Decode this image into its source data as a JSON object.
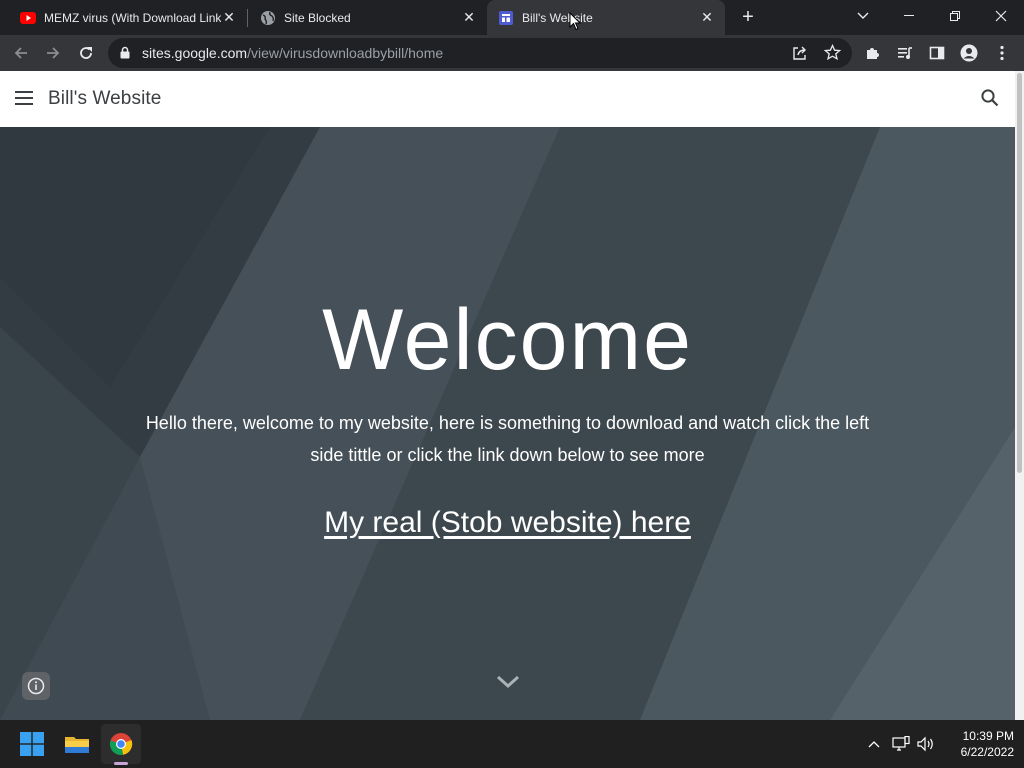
{
  "browser": {
    "tabs": [
      {
        "title": "MEMZ virus (With Download Link)",
        "favicon": "youtube-icon",
        "active": false
      },
      {
        "title": "Site Blocked",
        "favicon": "globe-icon",
        "active": false
      },
      {
        "title": "Bill's Website",
        "favicon": "google-sites-icon",
        "active": true
      }
    ],
    "address": {
      "host": "sites.google.com",
      "path": "/view/virusdownloadbybill/home"
    }
  },
  "site": {
    "title": "Bill's Website",
    "hero": {
      "heading": "Welcome",
      "intro": "Hello there, welcome to my website, here is something to download and watch click the left side tittle or click the link down below to see more",
      "link": "My real (Stob website) here"
    }
  },
  "taskbar": {
    "apps": [
      "windows-start-icon",
      "file-explorer-icon",
      "chrome-icon"
    ],
    "clock": {
      "time": "10:39 PM",
      "date": "6/22/2022"
    }
  },
  "colors": {
    "hero_bg": "#3f4a52",
    "chrome_dark": "#202124",
    "chrome_toolbar": "#35363a"
  }
}
